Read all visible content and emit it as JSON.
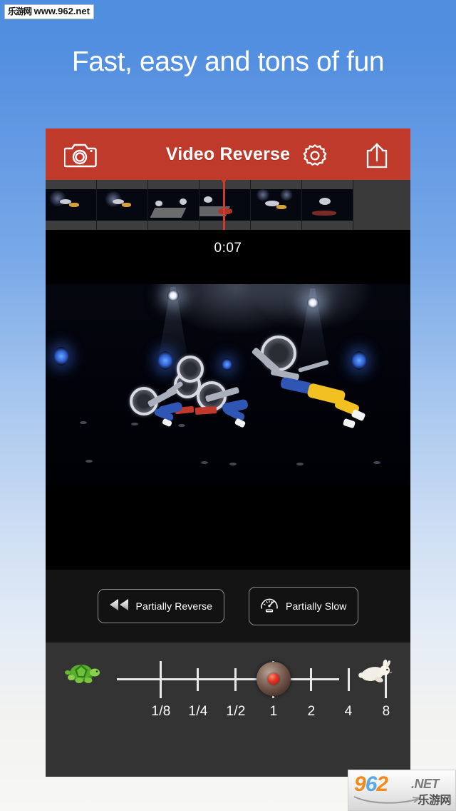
{
  "promo": {
    "headline": "Fast, easy and tons of fun",
    "background_top_color": "#4e8ddf",
    "background_bottom_color": "#f7f7f5"
  },
  "watermark_top": {
    "site_name_cn": "乐游网",
    "url": "www.962.net"
  },
  "watermark_logo": {
    "digit_9": "9",
    "digit_6": "6",
    "digit_2": "2",
    "tld": ".NET",
    "site_name_cn": "乐游网"
  },
  "app": {
    "header": {
      "title": "Video Reverse",
      "accent_color": "#bf3a2b",
      "camera_icon": "camera-icon",
      "settings_icon": "gear-icon",
      "share_icon": "share-icon"
    },
    "filmstrip": {
      "frame_count": 6,
      "playhead_label": "playhead-marker",
      "playhead_color": "#d0392b"
    },
    "player": {
      "timecode": "0:07",
      "scene_description": "Freestyle motocross riders mid-air over a darkened arena stage with spotlights"
    },
    "modes": [
      {
        "label": "Partially Reverse",
        "icon": "rewind-icon"
      },
      {
        "label": "Partially Slow",
        "icon": "speedometer-icon"
      }
    ],
    "speed_slider": {
      "slow_icon": "turtle-icon",
      "fast_icon": "rabbit-icon",
      "selected_value": "1",
      "ticks": [
        {
          "label": "1/8",
          "pos": 18
        },
        {
          "label": "1/4",
          "pos": 33
        },
        {
          "label": "1/2",
          "pos": 48
        },
        {
          "label": "1",
          "pos": 63
        },
        {
          "label": "2",
          "pos": 78
        },
        {
          "label": "4",
          "pos": 92
        },
        {
          "label": "8",
          "pos": 107
        }
      ]
    }
  }
}
